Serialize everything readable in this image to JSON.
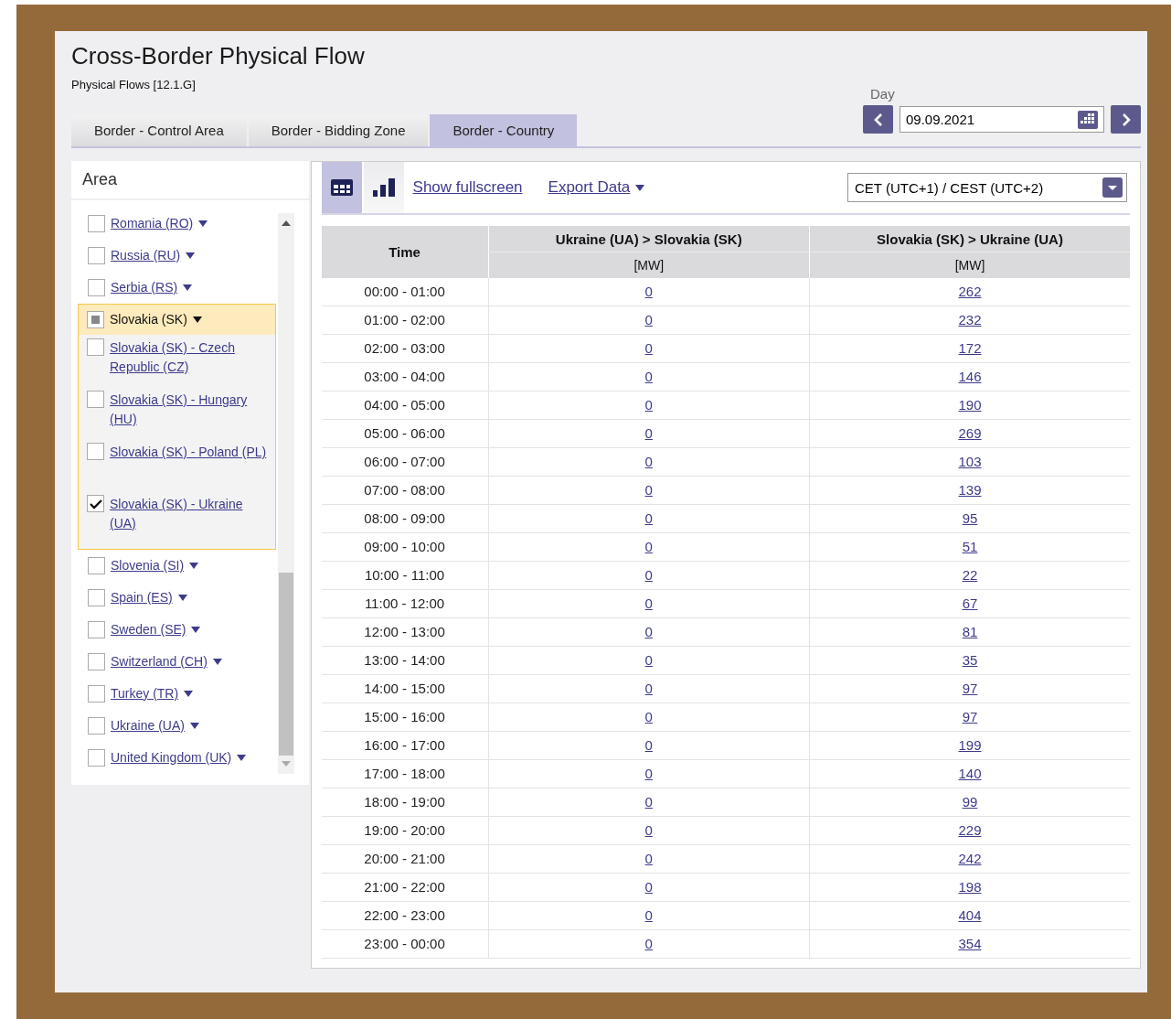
{
  "page": {
    "title": "Cross-Border Physical Flow",
    "subtitle": "Physical Flows [12.1.G]"
  },
  "tabs": [
    {
      "label": "Border - Control Area",
      "selected": false
    },
    {
      "label": "Border - Bidding Zone",
      "selected": false
    },
    {
      "label": "Border - Country",
      "selected": true
    }
  ],
  "day": {
    "label": "Day",
    "value": "09.09.2021"
  },
  "sidebar": {
    "title": "Area",
    "items": [
      {
        "label": "Romania (RO)",
        "checked": false,
        "indeterminate": false,
        "selected": false
      },
      {
        "label": "Russia (RU)",
        "checked": false,
        "indeterminate": false,
        "selected": false
      },
      {
        "label": "Serbia (RS)",
        "checked": false,
        "indeterminate": false,
        "selected": false
      },
      {
        "label": "Slovakia (SK)",
        "checked": false,
        "indeterminate": true,
        "selected": true,
        "children": [
          {
            "label": "Slovakia (SK) - Czech Republic (CZ)",
            "checked": false
          },
          {
            "label": "Slovakia (SK) - Hungary (HU)",
            "checked": false
          },
          {
            "label": "Slovakia (SK) - Poland (PL)",
            "checked": false
          },
          {
            "label": "Slovakia (SK) - Ukraine (UA)",
            "checked": true
          }
        ]
      },
      {
        "label": "Slovenia (SI)",
        "checked": false,
        "indeterminate": false,
        "selected": false
      },
      {
        "label": "Spain (ES)",
        "checked": false,
        "indeterminate": false,
        "selected": false
      },
      {
        "label": "Sweden (SE)",
        "checked": false,
        "indeterminate": false,
        "selected": false
      },
      {
        "label": "Switzerland (CH)",
        "checked": false,
        "indeterminate": false,
        "selected": false
      },
      {
        "label": "Turkey (TR)",
        "checked": false,
        "indeterminate": false,
        "selected": false
      },
      {
        "label": "Ukraine (UA)",
        "checked": false,
        "indeterminate": false,
        "selected": false
      },
      {
        "label": "United Kingdom (UK)",
        "checked": false,
        "indeterminate": false,
        "selected": false
      }
    ]
  },
  "toolbar": {
    "views": [
      {
        "kind": "table",
        "selected": true
      },
      {
        "kind": "chart",
        "selected": false
      }
    ],
    "fullscreen": "Show fullscreen",
    "export": "Export Data",
    "timezone": "CET (UTC+1) / CEST (UTC+2)"
  },
  "table": {
    "columns": [
      {
        "title": "Time"
      },
      {
        "title": "Ukraine (UA) > Slovakia (SK)",
        "unit": "[MW]"
      },
      {
        "title": "Slovakia (SK) > Ukraine (UA)",
        "unit": "[MW]"
      }
    ],
    "rows": [
      [
        "00:00 - 01:00",
        "0",
        "262"
      ],
      [
        "01:00 - 02:00",
        "0",
        "232"
      ],
      [
        "02:00 - 03:00",
        "0",
        "172"
      ],
      [
        "03:00 - 04:00",
        "0",
        "146"
      ],
      [
        "04:00 - 05:00",
        "0",
        "190"
      ],
      [
        "05:00 - 06:00",
        "0",
        "269"
      ],
      [
        "06:00 - 07:00",
        "0",
        "103"
      ],
      [
        "07:00 - 08:00",
        "0",
        "139"
      ],
      [
        "08:00 - 09:00",
        "0",
        "95"
      ],
      [
        "09:00 - 10:00",
        "0",
        "51"
      ],
      [
        "10:00 - 11:00",
        "0",
        "22"
      ],
      [
        "11:00 - 12:00",
        "0",
        "67"
      ],
      [
        "12:00 - 13:00",
        "0",
        "81"
      ],
      [
        "13:00 - 14:00",
        "0",
        "35"
      ],
      [
        "14:00 - 15:00",
        "0",
        "97"
      ],
      [
        "15:00 - 16:00",
        "0",
        "97"
      ],
      [
        "16:00 - 17:00",
        "0",
        "199"
      ],
      [
        "17:00 - 18:00",
        "0",
        "140"
      ],
      [
        "18:00 - 19:00",
        "0",
        "99"
      ],
      [
        "19:00 - 20:00",
        "0",
        "229"
      ],
      [
        "20:00 - 21:00",
        "0",
        "242"
      ],
      [
        "21:00 - 22:00",
        "0",
        "198"
      ],
      [
        "22:00 - 23:00",
        "0",
        "404"
      ],
      [
        "23:00 - 00:00",
        "0",
        "354"
      ]
    ]
  }
}
